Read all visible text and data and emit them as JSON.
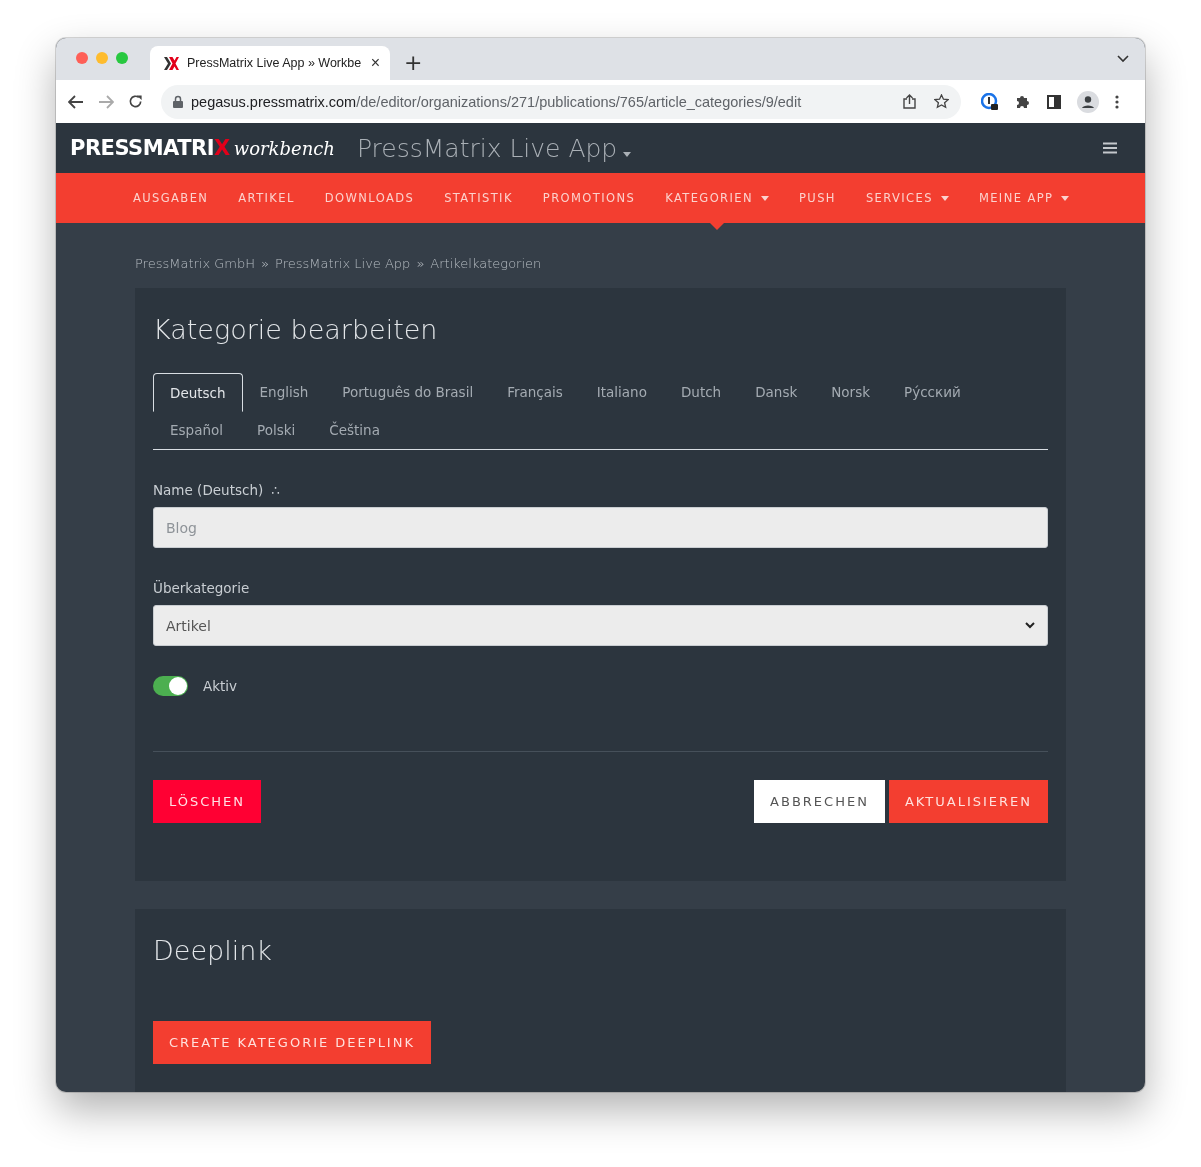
{
  "browser": {
    "tab_title": "PressMatrix Live App » Workbe",
    "close": "×",
    "new_tab": "+",
    "url_host": "pegasus.pressmatrix.com",
    "url_path": "/de/editor/organizations/271/publications/765/article_categories/9/edit"
  },
  "header": {
    "logo": "PRESSMATRIX",
    "logo_tagline": "workbench",
    "app_name": "PressMatrix Live App"
  },
  "nav": [
    {
      "label": "AUSGABEN",
      "selected": false,
      "has_menu": false
    },
    {
      "label": "ARTIKEL",
      "selected": false,
      "has_menu": false
    },
    {
      "label": "DOWNLOADS",
      "selected": false,
      "has_menu": false
    },
    {
      "label": "STATISTIK",
      "selected": false,
      "has_menu": false
    },
    {
      "label": "PROMOTIONS",
      "selected": false,
      "has_menu": false
    },
    {
      "label": "KATEGORIEN",
      "selected": true,
      "has_menu": true
    },
    {
      "label": "PUSH",
      "selected": false,
      "has_menu": false
    },
    {
      "label": "SERVICES",
      "selected": false,
      "has_menu": true
    },
    {
      "label": "MEINE APP",
      "selected": false,
      "has_menu": true
    }
  ],
  "breadcrumb": [
    {
      "label": "PressMatrix GmbH"
    },
    {
      "label": "PressMatrix Live App"
    },
    {
      "label": "Artikelkategorien"
    }
  ],
  "breadcrumb_separator": "»",
  "form": {
    "title": "Kategorie bearbeiten",
    "language_tabs": [
      {
        "label": "Deutsch",
        "selected": true
      },
      {
        "label": "English",
        "selected": false
      },
      {
        "label": "Português do Brasil",
        "selected": false
      },
      {
        "label": "Français",
        "selected": false
      },
      {
        "label": "Italiano",
        "selected": false
      },
      {
        "label": "Dutch",
        "selected": false
      },
      {
        "label": "Dansk",
        "selected": false
      },
      {
        "label": "Norsk",
        "selected": false
      },
      {
        "label": "Ру́сский",
        "selected": false
      },
      {
        "label": "Español",
        "selected": false
      },
      {
        "label": "Polski",
        "selected": false
      },
      {
        "label": "Čeština",
        "selected": false
      }
    ],
    "name_label": "Name (Deutsch)",
    "required_mark": "∴",
    "name_placeholder": "Blog",
    "parent_label": "Überkategorie",
    "parent_value": "Artikel",
    "active_label": "Aktiv",
    "active_on": true,
    "delete_button": "LÖSCHEN",
    "cancel_button": "ABBRECHEN",
    "update_button": "AKTUALISIEREN"
  },
  "deeplink": {
    "title": "Deeplink",
    "button": "CREATE KATEGORIE DEEPLINK"
  }
}
